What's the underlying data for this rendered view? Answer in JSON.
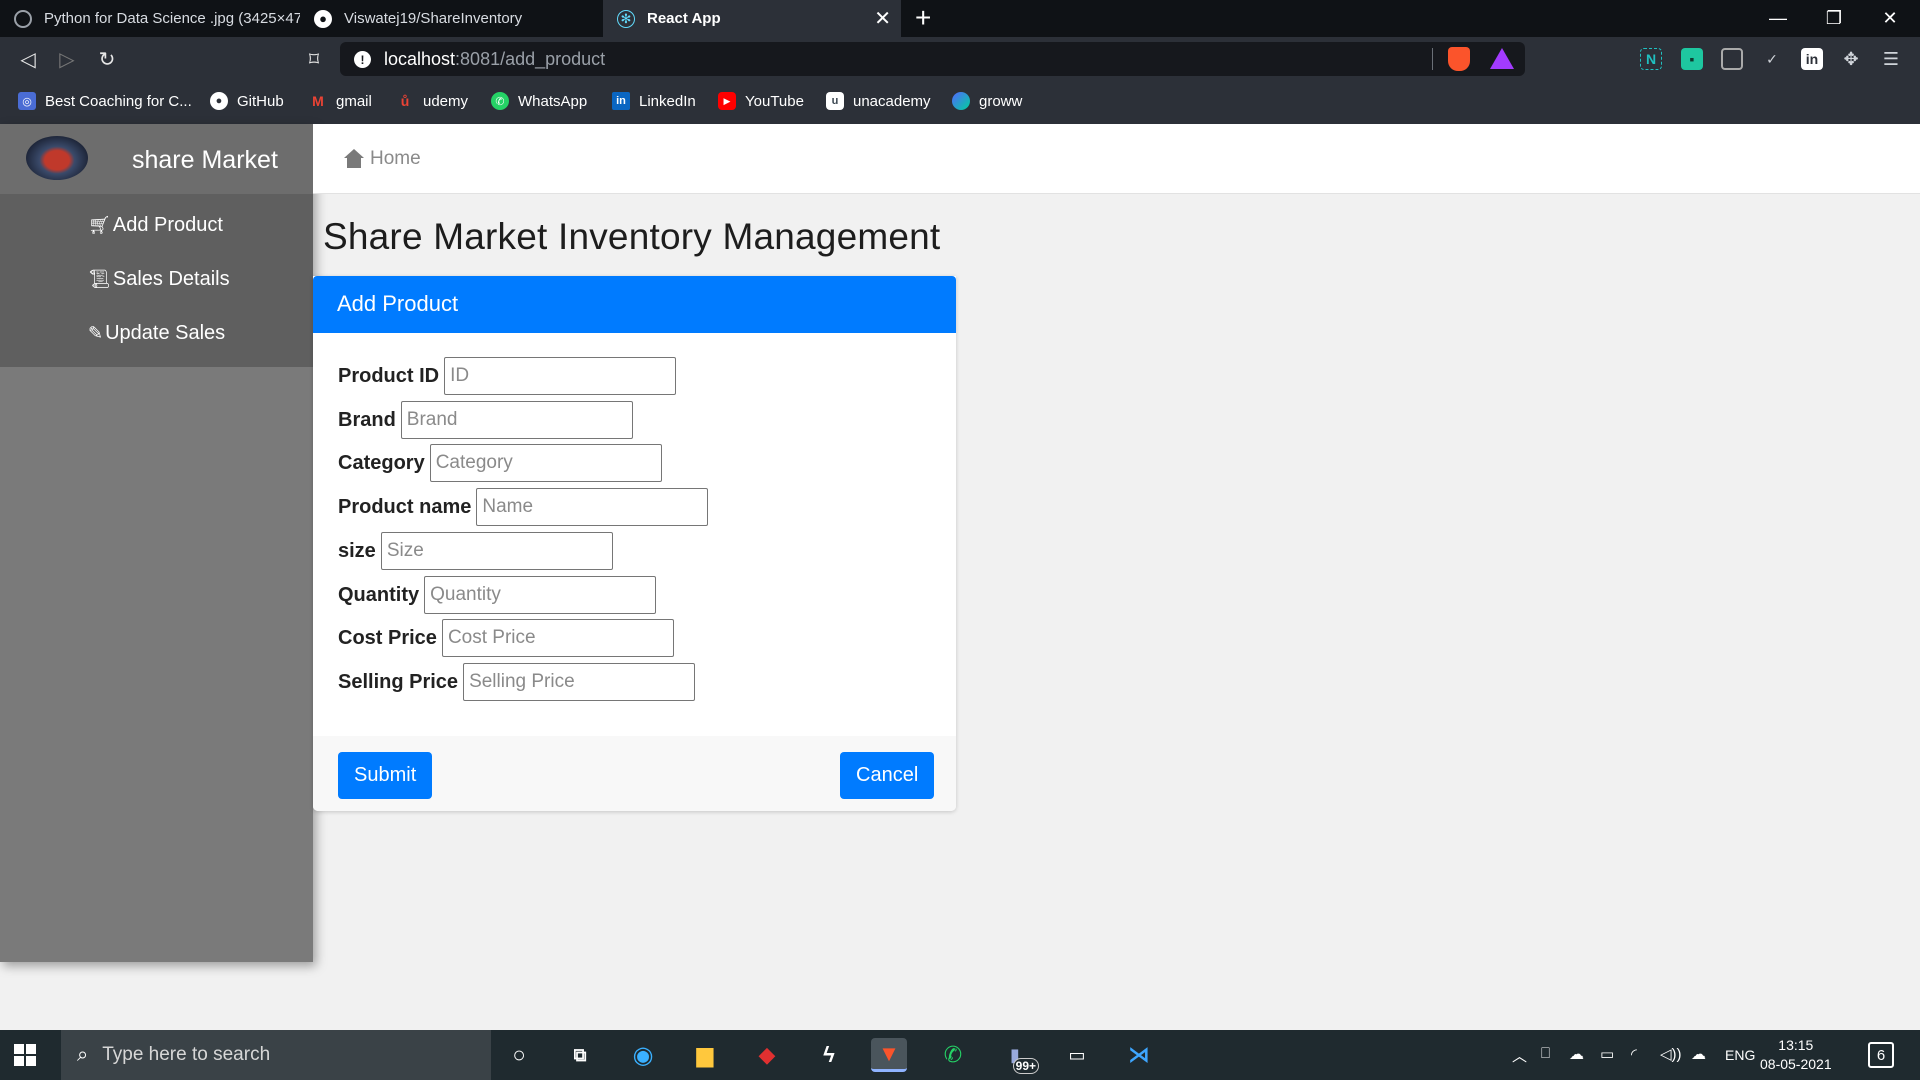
{
  "browser": {
    "tabs": [
      {
        "title": "Python for Data Science .jpg (3425×47",
        "icon": "globe-icon"
      },
      {
        "title": "Viswatej19/ShareInventory",
        "icon": "github-icon"
      },
      {
        "title": "React App",
        "icon": "react-icon"
      }
    ],
    "url": {
      "host": "localhost",
      "path": ":8081/add_product"
    },
    "bookmarks": [
      {
        "label": "Best Coaching for C...",
        "color": "#4a6cd4"
      },
      {
        "label": "GitHub",
        "color": "#ffffff"
      },
      {
        "label": "gmail",
        "color": "#ea4335"
      },
      {
        "label": "udemy",
        "color": "#a435f0"
      },
      {
        "label": "WhatsApp",
        "color": "#25d366"
      },
      {
        "label": "LinkedIn",
        "color": "#0a66c2"
      },
      {
        "label": "YouTube",
        "color": "#ff0000"
      },
      {
        "label": "unacademy",
        "color": "#3c4852"
      },
      {
        "label": "groww",
        "color": "#5367ff"
      }
    ]
  },
  "sidebar": {
    "brand": "share Market",
    "items": [
      {
        "label": "Add Product",
        "icon": "cart-icon"
      },
      {
        "label": "Sales Details",
        "icon": "scroll-icon"
      },
      {
        "label": "Update Sales",
        "icon": "pencil-icon"
      }
    ]
  },
  "topnav": {
    "home_label": "Home"
  },
  "main": {
    "title": "Share Market Inventory Management",
    "card_header": "Add Product",
    "fields": [
      {
        "label": "Product ID",
        "placeholder": "ID"
      },
      {
        "label": "Brand",
        "placeholder": "Brand"
      },
      {
        "label": "Category",
        "placeholder": "Category"
      },
      {
        "label": "Product name",
        "placeholder": "Name"
      },
      {
        "label": "size",
        "placeholder": "Size"
      },
      {
        "label": "Quantity",
        "placeholder": "Quantity"
      },
      {
        "label": "Cost Price",
        "placeholder": "Cost Price"
      },
      {
        "label": "Selling Price",
        "placeholder": "Selling Price"
      }
    ],
    "submit_label": "Submit",
    "cancel_label": "Cancel",
    "accent_color": "#007bff"
  },
  "taskbar": {
    "search_placeholder": "Type here to search",
    "badge": "99+",
    "language": "ENG",
    "time": "13:15",
    "date": "08-05-2021",
    "notifications": "6"
  }
}
